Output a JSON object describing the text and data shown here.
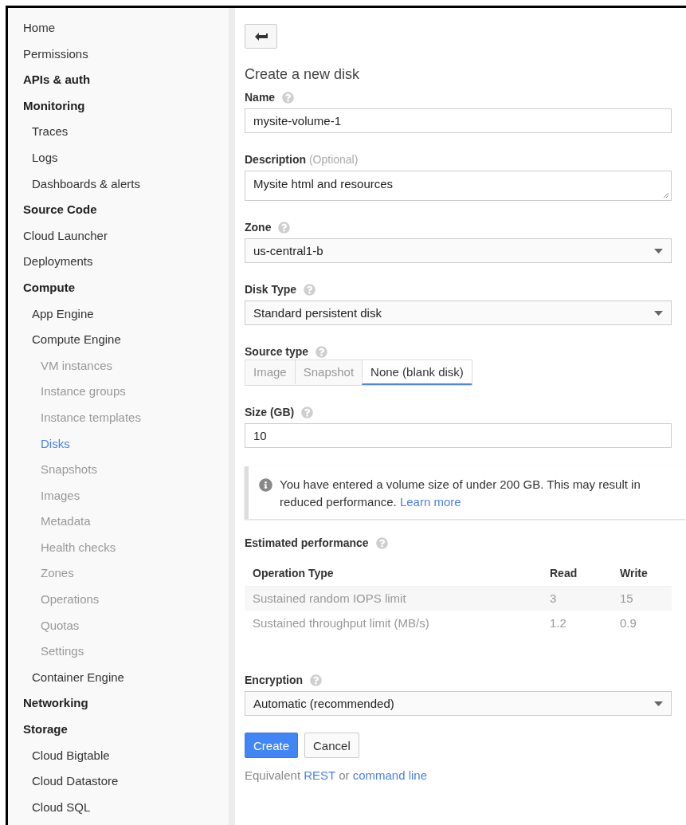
{
  "sidebar": {
    "items": [
      {
        "label": "Home",
        "kind": "link",
        "selected": false
      },
      {
        "label": "Permissions",
        "kind": "link",
        "selected": false
      },
      {
        "label": "APIs & auth",
        "kind": "heading",
        "selected": false
      },
      {
        "label": "Monitoring",
        "kind": "heading",
        "selected": false,
        "children": [
          {
            "label": "Traces",
            "kind": "link",
            "selected": false
          },
          {
            "label": "Logs",
            "kind": "link",
            "selected": false
          },
          {
            "label": "Dashboards & alerts",
            "kind": "link",
            "selected": false
          }
        ]
      },
      {
        "label": "Source Code",
        "kind": "heading",
        "selected": false
      },
      {
        "label": "Cloud Launcher",
        "kind": "link",
        "selected": false
      },
      {
        "label": "Deployments",
        "kind": "link",
        "selected": false
      },
      {
        "label": "Compute",
        "kind": "heading",
        "selected": false,
        "children": [
          {
            "label": "App Engine",
            "kind": "link",
            "selected": false
          },
          {
            "label": "Compute Engine",
            "kind": "link",
            "selected": false,
            "children": [
              {
                "label": "VM instances",
                "kind": "link",
                "selected": false
              },
              {
                "label": "Instance groups",
                "kind": "link",
                "selected": false
              },
              {
                "label": "Instance templates",
                "kind": "link",
                "selected": false
              },
              {
                "label": "Disks",
                "kind": "link",
                "selected": true
              },
              {
                "label": "Snapshots",
                "kind": "link",
                "selected": false
              },
              {
                "label": "Images",
                "kind": "link",
                "selected": false
              },
              {
                "label": "Metadata",
                "kind": "link",
                "selected": false
              },
              {
                "label": "Health checks",
                "kind": "link",
                "selected": false
              },
              {
                "label": "Zones",
                "kind": "link",
                "selected": false
              },
              {
                "label": "Operations",
                "kind": "link",
                "selected": false
              },
              {
                "label": "Quotas",
                "kind": "link",
                "selected": false
              },
              {
                "label": "Settings",
                "kind": "link",
                "selected": false
              }
            ]
          },
          {
            "label": "Container Engine",
            "kind": "link",
            "selected": false
          }
        ]
      },
      {
        "label": "Networking",
        "kind": "heading",
        "selected": false
      },
      {
        "label": "Storage",
        "kind": "heading",
        "selected": false,
        "children": [
          {
            "label": "Cloud Bigtable",
            "kind": "link",
            "selected": false
          },
          {
            "label": "Cloud Datastore",
            "kind": "link",
            "selected": false
          },
          {
            "label": "Cloud SQL",
            "kind": "link",
            "selected": false
          }
        ]
      }
    ]
  },
  "title": "Create a new disk",
  "fields": [
    {
      "kind": "text",
      "label": "Name",
      "help": true,
      "value": "mysite-volume-1"
    },
    {
      "kind": "textarea",
      "label": "Description",
      "note": "(Optional)",
      "help": false,
      "value": "Mysite html and resources"
    },
    {
      "kind": "select",
      "label": "Zone",
      "help": true,
      "value": "us-central1-b"
    },
    {
      "kind": "select",
      "label": "Disk Type",
      "help": true,
      "value": "Standard persistent disk"
    },
    {
      "kind": "tabs",
      "label": "Source type",
      "help": true,
      "options": [
        {
          "label": "Image",
          "selected": false
        },
        {
          "label": "Snapshot",
          "selected": false
        },
        {
          "label": "None (blank disk)",
          "selected": true
        }
      ]
    },
    {
      "kind": "text",
      "label": "Size (GB)",
      "help": true,
      "value": "10"
    }
  ],
  "notice": {
    "text": "You have entered a volume size of under 200 GB. This may result in reduced performance.",
    "link": "Learn more"
  },
  "performance": {
    "label": "Estimated performance",
    "help": true,
    "columns": [
      "Operation Type",
      "Read",
      "Write"
    ],
    "rows": [
      [
        "Sustained random IOPS limit",
        "3",
        "15"
      ],
      [
        "Sustained throughput limit (MB/s)",
        "1.2",
        "0.9"
      ]
    ]
  },
  "encryption": {
    "kind": "select",
    "label": "Encryption",
    "help": true,
    "value": "Automatic (recommended)"
  },
  "buttons": [
    {
      "label": "Create",
      "kind": "primary"
    },
    {
      "label": "Cancel",
      "kind": "secondary"
    }
  ],
  "footer": [
    {
      "kind": "text",
      "text": "Equivalent"
    },
    {
      "kind": "link",
      "text": "REST"
    },
    {
      "kind": "text",
      "text": "or"
    },
    {
      "kind": "link",
      "text": "command line"
    }
  ]
}
